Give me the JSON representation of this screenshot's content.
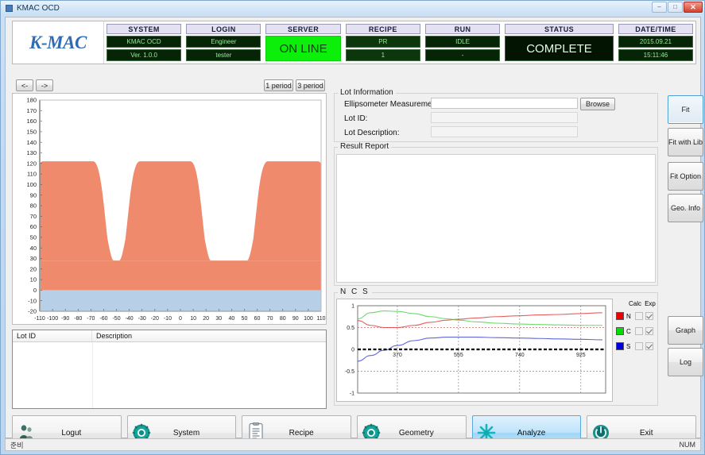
{
  "window": {
    "title": "KMAC OCD",
    "minimize_label": "–",
    "maximize_label": "□",
    "close_label": "✕"
  },
  "brand": {
    "logo_text": "K-MAC"
  },
  "status_header": {
    "columns": [
      {
        "head": "SYSTEM",
        "line1": "KMAC OCD",
        "line2": "Ver. 1.0.0"
      },
      {
        "head": "LOGIN",
        "line1": "Engineer",
        "line2": "tester"
      },
      {
        "head": "SERVER",
        "big": "ON LINE"
      },
      {
        "head": "RECIPE",
        "line1": "PR",
        "line2": "1"
      },
      {
        "head": "RUN",
        "line1": "IDLE",
        "line2": "-"
      },
      {
        "head": "STATUS",
        "big": "COMPLETE"
      },
      {
        "head": "DATE/TIME",
        "line1": "2015.09.21",
        "line2": "15:11:46"
      }
    ],
    "colors": {
      "online_green": "#0bef0b",
      "panel_dark": "#062406",
      "text_green": "#9fe89f",
      "head_bg": "#e4e2f2"
    }
  },
  "profile_toolbar": {
    "prev_label": "<-",
    "next_label": "->",
    "one_period_label": "1 period",
    "three_period_label": "3 period"
  },
  "chart_data": [
    {
      "type": "area",
      "name": "ocd-profile",
      "title": "",
      "xlabel": "",
      "ylabel": "",
      "xlim": [
        -110,
        110
      ],
      "ylim": [
        -20,
        180
      ],
      "xticks": [
        -110,
        -100,
        -90,
        -80,
        -70,
        -60,
        -50,
        -40,
        -30,
        -20,
        -10,
        0,
        10,
        20,
        30,
        40,
        50,
        60,
        70,
        80,
        90,
        100,
        110
      ],
      "yticks": [
        -20,
        -10,
        0,
        10,
        20,
        30,
        40,
        50,
        60,
        70,
        80,
        90,
        100,
        110,
        120,
        130,
        140,
        150,
        160,
        170,
        180
      ],
      "grid": false,
      "layers": [
        {
          "name": "substrate",
          "color": "#b8cfe8",
          "y_top": 0,
          "y_bottom": -20
        },
        {
          "name": "film",
          "color": "#f08a6c",
          "y_top": 28,
          "y_bottom": 0
        },
        {
          "name": "grating-lines",
          "color": "#f08a6c",
          "top": 122,
          "base": 28,
          "line_centers": [
            -88,
            -12,
            88
          ],
          "line_half_width": 26,
          "pitch": 76
        }
      ]
    },
    {
      "type": "line",
      "name": "ncs-spectra",
      "title": "N C S",
      "xlabel": "",
      "ylabel": "",
      "xlim": [
        250,
        1000
      ],
      "ylim": [
        -1,
        1
      ],
      "xticks": [
        370,
        555,
        740,
        925
      ],
      "yticks": [
        -1,
        -0.5,
        0,
        0.5,
        1
      ],
      "ytick_labels": [
        "-1",
        "-0.5",
        "0",
        "0.5",
        "1"
      ],
      "grid": true,
      "legend_position": "right",
      "series": [
        {
          "name": "N",
          "color": "#d92b2b",
          "x": [
            250,
            290,
            330,
            370,
            420,
            470,
            520,
            555,
            610,
            670,
            740,
            800,
            860,
            925,
            990
          ],
          "y": [
            0.66,
            0.55,
            0.5,
            0.5,
            0.55,
            0.62,
            0.67,
            0.69,
            0.72,
            0.75,
            0.77,
            0.79,
            0.8,
            0.82,
            0.84
          ]
        },
        {
          "name": "C",
          "color": "#3ecb3e",
          "x": [
            250,
            290,
            330,
            370,
            420,
            470,
            520,
            555,
            610,
            670,
            740,
            800,
            860,
            925,
            990
          ],
          "y": [
            0.7,
            0.84,
            0.88,
            0.87,
            0.82,
            0.75,
            0.7,
            0.67,
            0.63,
            0.6,
            0.58,
            0.57,
            0.56,
            0.55,
            0.55
          ]
        },
        {
          "name": "S",
          "color": "#2b34c8",
          "x": [
            250,
            290,
            330,
            370,
            420,
            470,
            520,
            555,
            610,
            670,
            740,
            800,
            860,
            925,
            990
          ],
          "y": [
            -0.27,
            -0.14,
            -0.02,
            0.09,
            0.2,
            0.26,
            0.28,
            0.28,
            0.28,
            0.27,
            0.26,
            0.25,
            0.24,
            0.23,
            0.22
          ]
        }
      ],
      "legend": {
        "col_headers": [
          "Calc",
          "Exp"
        ],
        "rows": [
          {
            "label": "N",
            "color": "#ee0000",
            "calc_checked": false,
            "exp_checked": true
          },
          {
            "label": "C",
            "color": "#00dd00",
            "calc_checked": false,
            "exp_checked": true
          },
          {
            "label": "S",
            "color": "#0000dd",
            "calc_checked": false,
            "exp_checked": true
          }
        ]
      }
    }
  ],
  "lot_table": {
    "columns": [
      "Lot ID",
      "Description"
    ],
    "rows": []
  },
  "lot_information": {
    "group_label": "Lot Information",
    "fields": [
      {
        "label": "Ellipsometer Measurement file:",
        "value": "",
        "placeholder": ""
      },
      {
        "label": "Lot ID:",
        "value": "",
        "placeholder": ""
      },
      {
        "label": "Lot Description:",
        "value": "",
        "placeholder": ""
      }
    ],
    "browse_label": "Browse"
  },
  "result_report": {
    "group_label": "Result Report",
    "content": ""
  },
  "ncs_panel": {
    "group_label": "N C S"
  },
  "side_buttons": [
    {
      "label": "Fit",
      "focused": true
    },
    {
      "label": "Fit with Lib",
      "focused": false
    },
    {
      "label": "Fit Option",
      "focused": false
    },
    {
      "label": "Geo. Info",
      "focused": false
    },
    {
      "label": "Graph",
      "focused": false
    },
    {
      "label": "Log",
      "focused": false
    }
  ],
  "toolbar": {
    "buttons": [
      {
        "label": "Logut",
        "icon": "user-icon",
        "active": false
      },
      {
        "label": "System",
        "icon": "gear-icon",
        "active": false
      },
      {
        "label": "Recipe",
        "icon": "document-icon",
        "active": false
      },
      {
        "label": "Geometry",
        "icon": "gear-icon",
        "active": false
      },
      {
        "label": "Analyze",
        "icon": "snowflake-icon",
        "active": true
      },
      {
        "label": "Exit",
        "icon": "power-icon",
        "active": false
      }
    ]
  },
  "bottom_status": {
    "left": "준비",
    "right": "NUM"
  }
}
